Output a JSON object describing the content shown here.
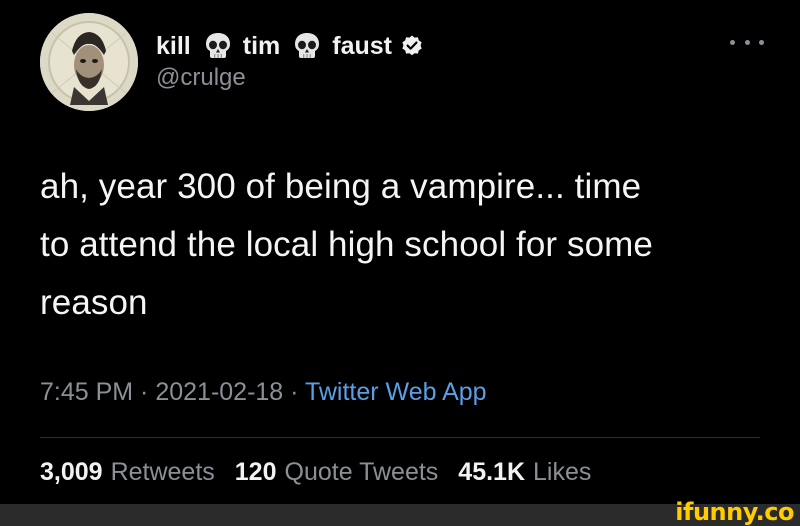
{
  "author": {
    "name_parts": [
      "kill",
      "tim",
      "faust"
    ],
    "separator_icon": "skull-emoji",
    "verified": true,
    "handle": "@crulge",
    "avatar_icon": "profile-picture"
  },
  "more_icon": "ellipsis-icon",
  "tweet": {
    "lines": [
      "ah, year 300 of being a vampire... time",
      "to attend the local high school for some",
      "reason"
    ]
  },
  "meta": {
    "time": "7:45 PM",
    "sep": " · ",
    "date": "2021-02-18",
    "app": "Twitter Web App"
  },
  "stats": {
    "retweets": {
      "count": "3,009",
      "label": "Retweets"
    },
    "quote_tweets": {
      "count": "120",
      "label": "Quote Tweets"
    },
    "likes": {
      "count": "45.1K",
      "label": "Likes"
    }
  },
  "watermark": "ifunny.co",
  "colors": {
    "background": "#000000",
    "link": "#5b9ee6",
    "muted": "#8b9096",
    "watermark": "#ffcc00"
  }
}
